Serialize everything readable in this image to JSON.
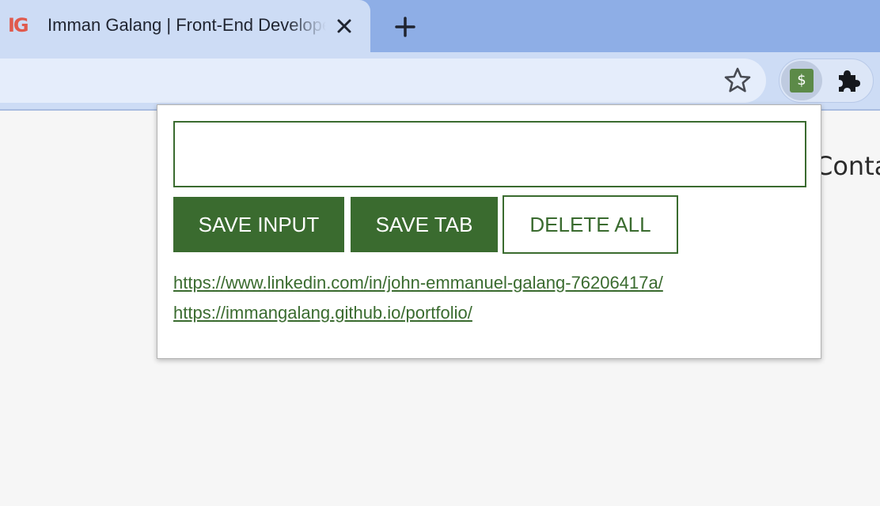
{
  "browser": {
    "tab": {
      "favicon_text": "IG",
      "title": "Imman Galang | Front-End Developer",
      "close_icon": "close-icon"
    },
    "new_tab_icon": "plus-icon",
    "toolbar": {
      "bookmark_icon": "star-outline-icon",
      "extensions": [
        {
          "name": "money-extension-icon",
          "symbol": "$",
          "color": "#5c8a48"
        },
        {
          "name": "puzzle-icon"
        }
      ]
    }
  },
  "page": {
    "nav_partial_text": "Conta"
  },
  "popup": {
    "input": {
      "value": "",
      "placeholder": ""
    },
    "buttons": {
      "save_input": "SAVE INPUT",
      "save_tab": "SAVE TAB",
      "delete_all": "DELETE ALL"
    },
    "leads": [
      "https://www.linkedin.com/in/john-emmanuel-galang-76206417a/",
      "https://immangalang.github.io/portfolio/"
    ]
  },
  "colors": {
    "accent": "#3a6b2f",
    "tabstrip": "#8eaee6",
    "active_tab": "#cddcf5",
    "page_background": "#f6f6f6"
  }
}
